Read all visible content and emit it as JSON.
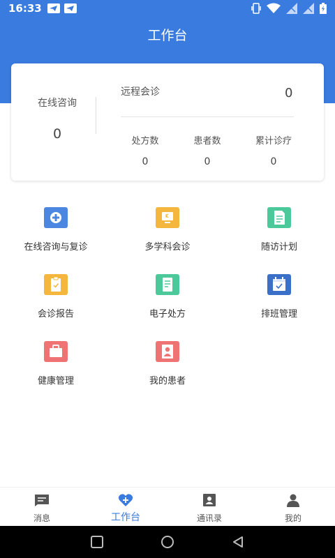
{
  "status_bar": {
    "time": "16:33"
  },
  "header": {
    "title": "工作台"
  },
  "stats_card": {
    "online_consult": {
      "label": "在线咨询",
      "value": "0"
    },
    "remote_consult": {
      "label": "远程会诊",
      "value": "0"
    },
    "stats": [
      {
        "label": "处方数",
        "value": "0"
      },
      {
        "label": "患者数",
        "value": "0"
      },
      {
        "label": "累计诊疗",
        "value": "0"
      }
    ]
  },
  "grid": [
    {
      "label": "在线咨询与复诊",
      "icon": "medical-plus-icon",
      "color": "#4b86e0"
    },
    {
      "label": "多学科会诊",
      "icon": "monitor-icon",
      "color": "#f4b63d"
    },
    {
      "label": "随访计划",
      "icon": "clipboard-plan-icon",
      "color": "#4cc99a"
    },
    {
      "label": "会诊报告",
      "icon": "clipboard-check-icon",
      "color": "#f4b63d"
    },
    {
      "label": "电子处方",
      "icon": "prescription-icon",
      "color": "#4cc99a"
    },
    {
      "label": "排班管理",
      "icon": "calendar-check-icon",
      "color": "#4b86e0"
    },
    {
      "label": "健康管理",
      "icon": "briefcase-icon",
      "color": "#f07373"
    },
    {
      "label": "我的患者",
      "icon": "patient-icon",
      "color": "#f07373"
    }
  ],
  "tabs": [
    {
      "label": "消息",
      "icon": "message-icon"
    },
    {
      "label": "工作台",
      "icon": "heart-plus-icon"
    },
    {
      "label": "通讯录",
      "icon": "contacts-icon"
    },
    {
      "label": "我的",
      "icon": "person-icon"
    }
  ],
  "colors": {
    "primary": "#3a7bdf"
  }
}
